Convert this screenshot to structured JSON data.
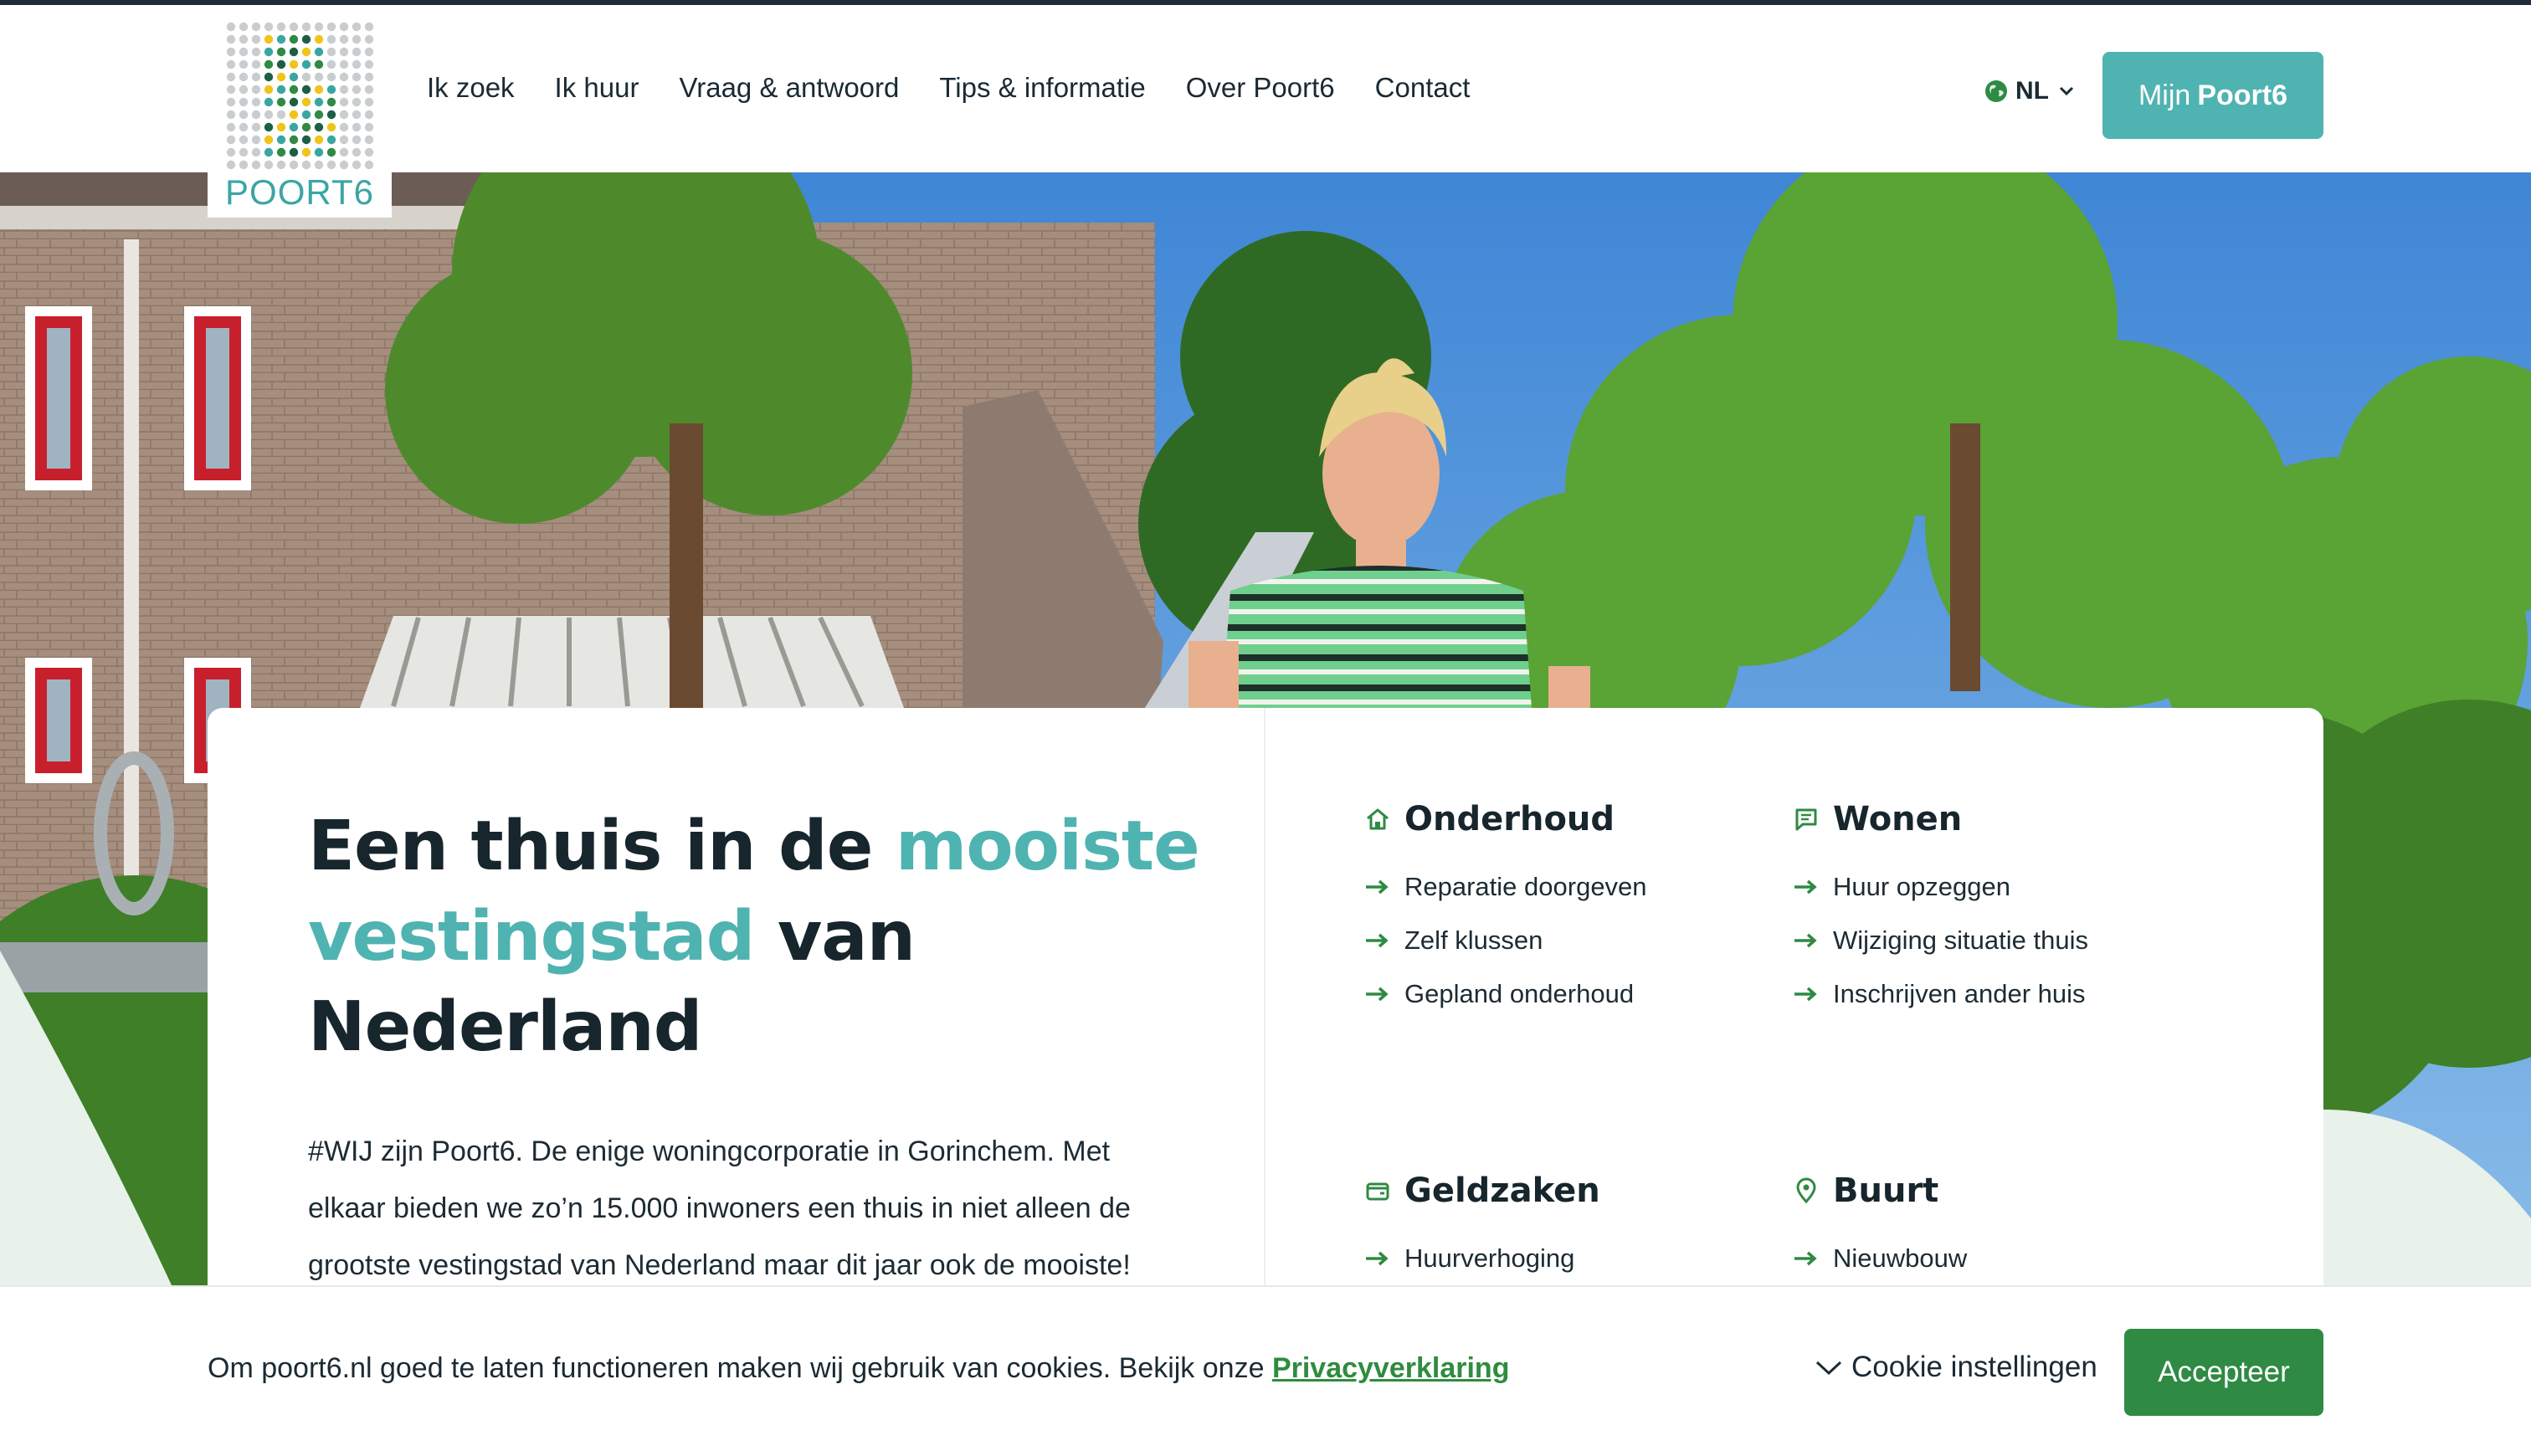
{
  "brand": {
    "logo_text": "POORT6",
    "accent_color": "#4fb3b1",
    "green_color": "#2f8a43"
  },
  "nav": {
    "items": [
      {
        "label": "Ik zoek"
      },
      {
        "label": "Ik huur"
      },
      {
        "label": "Vraag & antwoord"
      },
      {
        "label": "Tips & informatie"
      },
      {
        "label": "Over Poort6"
      },
      {
        "label": "Contact"
      }
    ],
    "language": "NL",
    "account_prefix": "Mijn",
    "account_brand": "Poort6"
  },
  "hero": {
    "headline_part1": "Een thuis in de ",
    "headline_accent": "mooiste vestingstad",
    "headline_part2": " van Nederland",
    "intro": "#WIJ zijn Poort6. De enige woningcorporatie in Gorinchem. Met elkaar bieden we zo’n 15.000 inwoners een thuis in niet alleen de grootste vestingstad van Nederland maar dit jaar ook de mooiste!"
  },
  "topics": [
    {
      "title": "Onderhoud",
      "icon": "house-icon",
      "links": [
        "Reparatie doorgeven",
        "Zelf klussen",
        "Gepland onderhoud"
      ]
    },
    {
      "title": "Wonen",
      "icon": "message-icon",
      "links": [
        "Huur opzeggen",
        "Wijziging situatie thuis",
        "Inschrijven ander huis"
      ]
    },
    {
      "title": "Geldzaken",
      "icon": "wallet-icon",
      "links": [
        "Huurverhoging"
      ]
    },
    {
      "title": "Buurt",
      "icon": "location-pin-icon",
      "links": [
        "Nieuwbouw"
      ]
    }
  ],
  "cookie": {
    "text": "Om poort6.nl goed te laten functioneren maken wij gebruik van cookies. Bekijk onze ",
    "link_label": "Privacyverklaring",
    "settings_label": "Cookie instellingen",
    "accept_label": "Accepteer"
  }
}
